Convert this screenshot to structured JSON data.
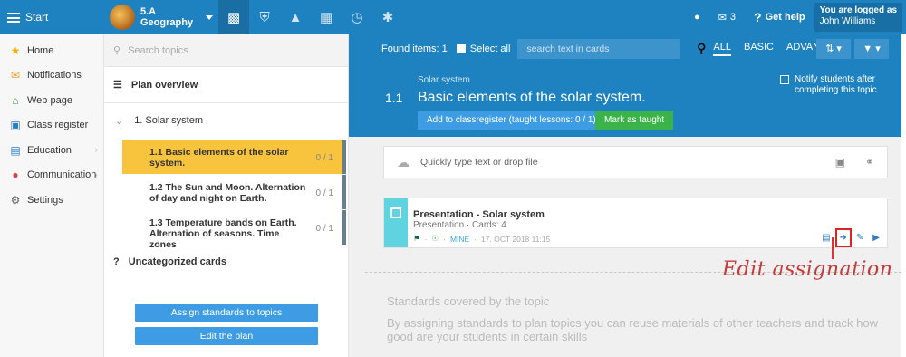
{
  "topbar": {
    "menu_label": "Start",
    "class_name": "5.A",
    "class_subject": "Geography",
    "messages_count": "3",
    "help_label": "Get help",
    "logged_label": "You are logged as",
    "user_name": "John Williams"
  },
  "leftnav": {
    "items": [
      {
        "label": "Home",
        "icon": "star-icon"
      },
      {
        "label": "Notifications",
        "icon": "mail-icon"
      },
      {
        "label": "Web page",
        "icon": "home-icon"
      },
      {
        "label": "Class register",
        "icon": "register-icon"
      },
      {
        "label": "Education",
        "icon": "education-icon"
      },
      {
        "label": "Communication",
        "icon": "communication-icon"
      },
      {
        "label": "Settings",
        "icon": "gear-icon"
      }
    ]
  },
  "topics": {
    "search_placeholder": "Search topics",
    "plan_overview": "Plan overview",
    "solar_system": "1. Solar system",
    "subtopics": [
      {
        "label": "1.1 Basic elements of the solar system.",
        "count": "0 / 1"
      },
      {
        "label": "1.2 The Sun and Moon. Alternation of day and night on Earth.",
        "count": "0 / 1"
      },
      {
        "label": "1.3 Temperature bands on Earth. Alternation of seasons. Time zones",
        "count": "0 / 1"
      }
    ],
    "uncategorized_mark": "?",
    "uncategorized": "Uncategorized cards",
    "assign_btn": "Assign standards to topics",
    "edit_btn": "Edit the plan"
  },
  "main": {
    "found_items": "Found items: 1",
    "select_all": "Select all",
    "search_placeholder": "search text in cards",
    "tabs": [
      "ALL",
      "BASIC",
      "ADVANCED"
    ],
    "topic_crumb": "Solar system",
    "topic_number": "1.1",
    "topic_title": "Basic elements of the solar system.",
    "add_btn": "Add to classregister (taught lessons: 0 / 1)",
    "mark_btn": "Mark as taught",
    "notify_label": "Notify students after completing this topic",
    "drop_placeholder": "Quickly type text or drop file",
    "card": {
      "title": "Presentation - Solar system",
      "subtitle": "Presentation · Cards: 4",
      "owner": "MINE",
      "date": "17. OCT 2018 11:15"
    },
    "standards_title": "Standards covered by the topic",
    "standards_text": "By assigning standards to plan topics you can reuse materials of other teachers and track how good are your students in certain skills"
  },
  "annotation": "Edit assignation",
  "colors": {
    "brand_blue": "#1f82c0",
    "active_topic": "#f9c43d",
    "green_btn": "#3bb34a",
    "accent_cyan": "#5fd3e0",
    "annotation_red": "#c73a3a"
  }
}
